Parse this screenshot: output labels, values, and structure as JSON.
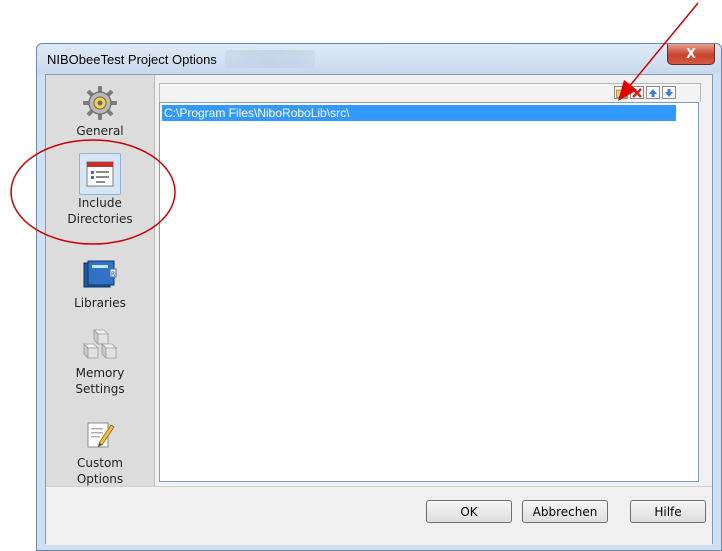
{
  "window": {
    "title": "NIBObeeTest Project Options",
    "close_label": "X"
  },
  "sidebar": {
    "items": [
      {
        "label": "General",
        "icon": "gear-icon",
        "selected": false
      },
      {
        "label": "Include Directories",
        "icon": "include-directories-icon",
        "selected": true
      },
      {
        "label": "Libraries",
        "icon": "libraries-icon",
        "selected": false
      },
      {
        "label": "Memory Settings",
        "icon": "memory-blocks-icon",
        "selected": false
      },
      {
        "label": "Custom Options",
        "icon": "notepad-pencil-icon",
        "selected": false
      }
    ]
  },
  "toolbar": {
    "buttons": [
      "new-folder-icon",
      "delete-icon",
      "move-up-icon",
      "move-down-icon"
    ]
  },
  "directory_list": {
    "items": [
      "C:\\Program Files\\NiboRoboLib\\src\\"
    ],
    "selected_index": 0
  },
  "footer": {
    "ok_label": "OK",
    "cancel_label": "Abbrechen",
    "help_label": "Hilfe"
  },
  "colors": {
    "selection": "#3399ff",
    "annotation": "#cc0000",
    "close_button": "#c7432b"
  }
}
